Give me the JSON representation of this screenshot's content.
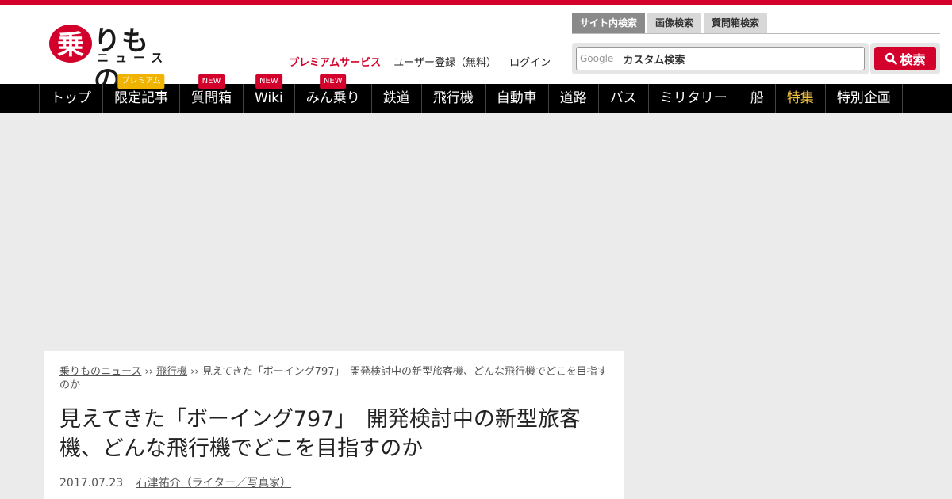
{
  "logo": {
    "text": "りもの",
    "sub": "ニュース"
  },
  "account": {
    "premium": "プレミアムサービス",
    "register": "ユーザー登録（無料）",
    "login": "ログイン"
  },
  "search": {
    "tabs": [
      "サイト内検索",
      "画像検索",
      "質問箱検索"
    ],
    "google_label": "Google",
    "placeholder": "カスタム検索",
    "button_label": "検索"
  },
  "nav": {
    "items": [
      {
        "label": "トップ"
      },
      {
        "label": "限定記事",
        "badge": "プレミアム"
      },
      {
        "label": "質問箱",
        "badge": "NEW"
      },
      {
        "label": "Wiki",
        "badge": "NEW"
      },
      {
        "label": "みん乗り",
        "badge": "NEW"
      },
      {
        "label": "鉄道"
      },
      {
        "label": "飛行機"
      },
      {
        "label": "自動車"
      },
      {
        "label": "道路"
      },
      {
        "label": "バス"
      },
      {
        "label": "ミリタリー"
      },
      {
        "label": "船"
      },
      {
        "label": "特集"
      },
      {
        "label": "特別企画"
      }
    ]
  },
  "article": {
    "breadcrumb": {
      "home": "乗りものニュース",
      "sep1": " ›› ",
      "category": "飛行機",
      "sep2": " ›› ",
      "current": "見えてきた「ボーイング797」　開発検討中の新型旅客機、どんな飛行機でどこを目指すのか"
    },
    "title": "見えてきた「ボーイング797」　開発検討中の新型旅客機、どんな飛行機でどこを目指すのか",
    "date": "2017.07.23",
    "author": "石津祐介（ライター／写真家）"
  },
  "colors": {
    "brand": "#d2002a",
    "nav_bg": "#000000",
    "highlight": "#f0c040"
  }
}
